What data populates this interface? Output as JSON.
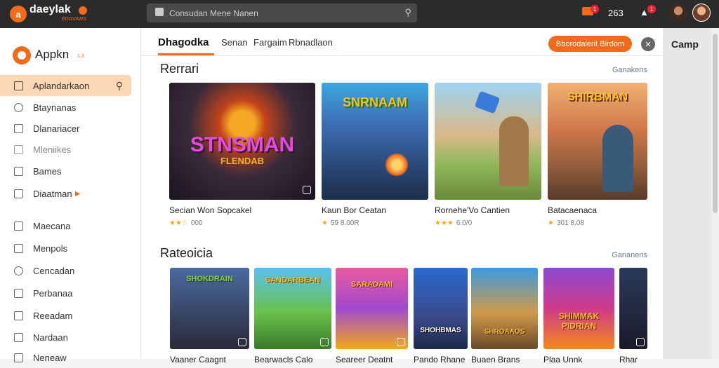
{
  "topbar": {
    "logo_mark": "a",
    "logo_text": "daeylak",
    "logo_sub": "EDGVAWS",
    "search_placeholder": "Consudan Mene Nanen",
    "count": "263",
    "notif_count_1": "1",
    "notif_count_2": "1"
  },
  "sidebar": {
    "brand": "Appkn",
    "brand_tag": "1.3",
    "items": [
      {
        "label": "Aplandarkaon",
        "icon": "apps-icon"
      },
      {
        "label": "Btaynanas",
        "icon": "gear-icon"
      },
      {
        "label": "Dlanariacer",
        "icon": "folder-icon"
      },
      {
        "label": "Mleniikes",
        "icon": "wrench-icon"
      },
      {
        "label": "Bames",
        "icon": "grid-icon"
      },
      {
        "label": "Diaatman",
        "icon": "list-icon"
      },
      {
        "label": "Maecana",
        "icon": "box-icon"
      },
      {
        "label": "Menpols",
        "icon": "square-icon"
      },
      {
        "label": "Cencadan",
        "icon": "key-icon"
      },
      {
        "label": "Perbanaa",
        "icon": "photo-icon"
      },
      {
        "label": "Reeadam",
        "icon": "book-icon"
      },
      {
        "label": "Nardaan",
        "icon": "tag-icon"
      },
      {
        "label": "Neneaw",
        "icon": "star-icon"
      }
    ]
  },
  "main": {
    "tabs": [
      "Dhagodka",
      "Senan",
      "Fargaim",
      "Rbnadlaon"
    ],
    "primary_button": "Bborodalent Birdom",
    "featured": {
      "title": "Rerrari",
      "more": "Ganakens",
      "cards": [
        {
          "title": "Secian Won Sopcakel",
          "rating": "000",
          "stars": "★★☆",
          "thumb_text": "STNSMAN",
          "thumb_sub": "FLENDAB"
        },
        {
          "title": "Kaun Bor Ceatan",
          "rating": "59 8.00R",
          "stars": "★",
          "thumb_text": "SNRNAAM",
          "thumb_sub": ""
        },
        {
          "title": "Rornehe'Vo Cantien",
          "rating": "6.0/0",
          "stars": "★★★",
          "thumb_text": "",
          "thumb_sub": ""
        },
        {
          "title": "Batacaenaca",
          "rating": "301 8.08",
          "stars": "★",
          "thumb_text": "SHIRBMAN",
          "thumb_sub": ""
        }
      ]
    },
    "categories": {
      "title": "Rateoicia",
      "more": "Gananens",
      "cards": [
        {
          "title": "Vaaner Caagnt",
          "thumb_text": "SHOKDRAIN"
        },
        {
          "title": "Bearwacls Calo",
          "thumb_text": "SANDARBEAN"
        },
        {
          "title": "Seareer Deatnt",
          "thumb_text": "SARADAMI"
        },
        {
          "title": "Pando Rhane",
          "thumb_text": "SHOHBMAS"
        },
        {
          "title": "Buaen Brans",
          "thumb_text": "SHROAAOS"
        },
        {
          "title": "Plaa Unnk",
          "thumb_text": "SHIMMAK PIDRIAN"
        },
        {
          "title": "Rhar",
          "thumb_text": ""
        }
      ]
    }
  },
  "right_panel": {
    "title": "Camp"
  }
}
